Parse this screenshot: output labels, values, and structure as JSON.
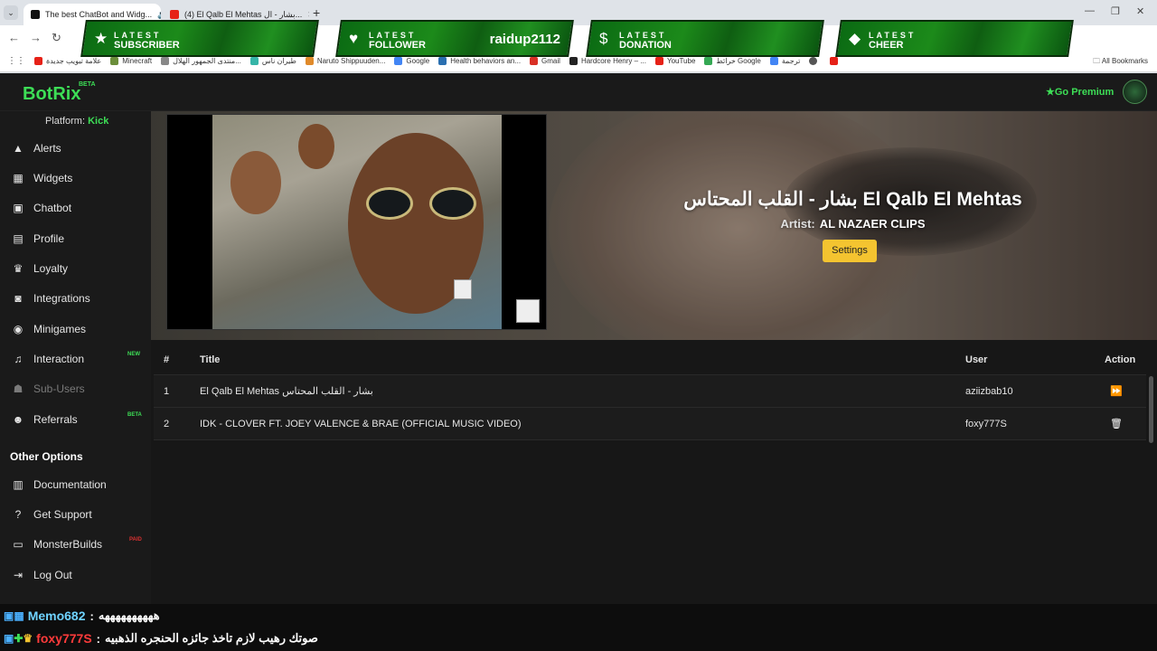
{
  "browser": {
    "tabs": [
      {
        "title": "The best ChatBot and Widg...",
        "active": true
      },
      {
        "title": "(4) El Qalb El Mehtas بشار - ال...",
        "active": false
      }
    ],
    "bookmarks": [
      "علامة تبويب جديدة",
      "Minecraft",
      "منتدى الجمهور الهلال...",
      "طيران ناس",
      "Naruto Shippuuden...",
      "Google",
      "Health behaviors an...",
      "Gmail",
      "Hardcore Henry – ...",
      "YouTube",
      "خرائط Google",
      "ترجمة"
    ],
    "all_bookmarks": "All Bookmarks"
  },
  "alerts": [
    {
      "line1": "LATEST",
      "line2": "SUBSCRIBER",
      "value": "",
      "icon": "star-icon"
    },
    {
      "line1": "LATEST",
      "line2": "FOLLOWER",
      "value": "raidup2112",
      "icon": "heart-icon"
    },
    {
      "line1": "LATEST",
      "line2": "DONATION",
      "value": "",
      "icon": "dollar-icon"
    },
    {
      "line1": "LATEST",
      "line2": "CHEER",
      "value": "",
      "icon": "diamond-icon"
    }
  ],
  "header": {
    "logo": "BotRix",
    "logo_badge": "BETA",
    "premium": "Go Premium"
  },
  "sidebar": {
    "platform_label": "Platform:",
    "platform_value": "Kick",
    "items": [
      {
        "label": "Alerts",
        "icon": "warning-icon",
        "badge": ""
      },
      {
        "label": "Widgets",
        "icon": "grid-icon",
        "badge": ""
      },
      {
        "label": "Chatbot",
        "icon": "robot-icon",
        "badge": ""
      },
      {
        "label": "Profile",
        "icon": "id-card-icon",
        "badge": ""
      },
      {
        "label": "Loyalty",
        "icon": "trophy-icon",
        "badge": ""
      },
      {
        "label": "Integrations",
        "icon": "plug-icon",
        "badge": ""
      },
      {
        "label": "Minigames",
        "icon": "gamepad-icon",
        "badge": ""
      },
      {
        "label": "Interaction",
        "icon": "music-icon",
        "badge": "NEW"
      },
      {
        "label": "Sub-Users",
        "icon": "users-icon",
        "badge": ""
      },
      {
        "label": "Referrals",
        "icon": "user-plus-icon",
        "badge": "BETA"
      }
    ],
    "other_title": "Other Options",
    "other_items": [
      {
        "label": "Documentation",
        "icon": "document-icon",
        "badge": ""
      },
      {
        "label": "Get Support",
        "icon": "question-icon",
        "badge": ""
      },
      {
        "label": "MonsterBuilds",
        "icon": "laptop-icon",
        "badge": "PAID"
      },
      {
        "label": "Log Out",
        "icon": "logout-icon",
        "badge": ""
      }
    ]
  },
  "now_playing": {
    "title": "بشار - القلب المحتاس El Qalb El Mehtas",
    "artist_label": "Artist:",
    "artist": "AL NAZAER CLIPS",
    "settings": "Settings"
  },
  "queue": {
    "columns": [
      "#",
      "Title",
      "User",
      "Action"
    ],
    "rows": [
      {
        "num": "1",
        "title": "El Qalb El Mehtas بشار - القلب المحتاس",
        "user": "aziizbab10",
        "action": "skip"
      },
      {
        "num": "2",
        "title": "IDK - CLOVER FT. JOEY VALENCE & BRAE (OFFICIAL MUSIC VIDEO)",
        "user": "foxy777S",
        "action": "delete"
      }
    ]
  },
  "chat": [
    {
      "user": "Memo682",
      "message": "ههههههههههه"
    },
    {
      "user": "foxy777S",
      "message": "صوتك رهيب لازم تاخذ جائزه الحنجره الذهبيه"
    }
  ],
  "colors": {
    "accent": "#3dde56",
    "settings_button": "#f4c430",
    "alert_green": "#1c8a1a"
  }
}
